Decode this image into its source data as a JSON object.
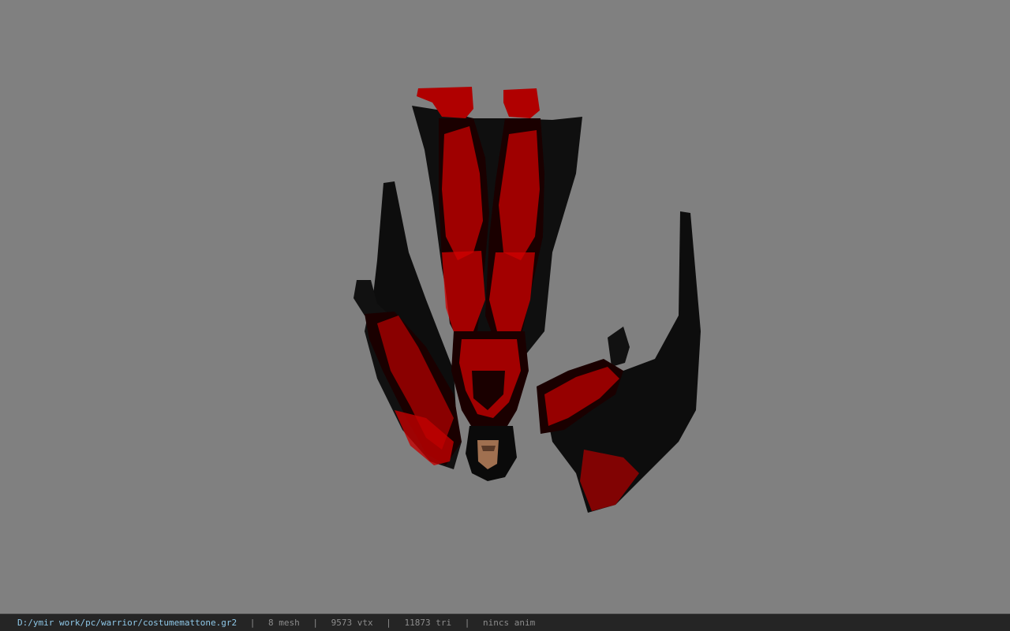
{
  "viewport": {
    "background": "#808080",
    "model_name": "costumemattone"
  },
  "statusbar": {
    "path": "D:/ymir work/pc/warrior/costumemattone.gr2",
    "mesh": "8 mesh",
    "vtx": "9573 vtx",
    "tri": "11873 tri",
    "anim": "nincs anim",
    "separator": "|",
    "path_color": "#8fc8e8",
    "text_color": "#8c8c8c"
  }
}
